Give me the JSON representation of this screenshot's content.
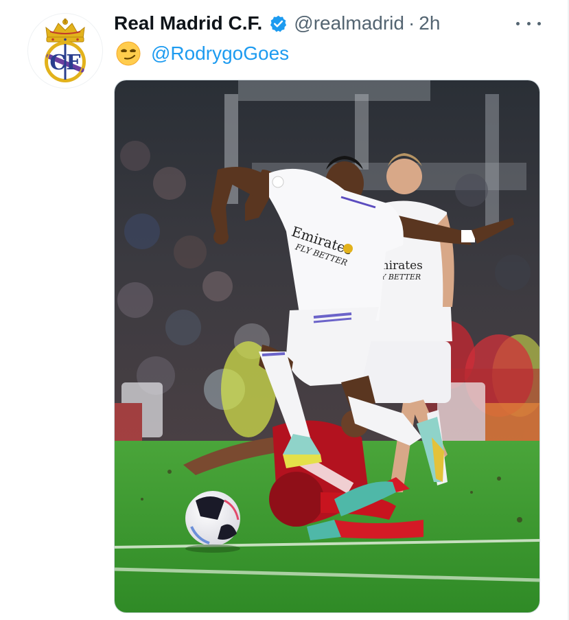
{
  "author": {
    "display_name": "Real Madrid C.F.",
    "handle": "@realmadrid",
    "separator": "·",
    "timestamp": "2h",
    "verified": true,
    "avatar_icon": "real-madrid-crest-icon"
  },
  "tweet": {
    "emoji": "😏",
    "mention": "@RodrygoGoes"
  },
  "media": {
    "kind": "photo",
    "jersey_sponsor_line1": "Emirates",
    "jersey_sponsor_line2": "FLY BETTER"
  },
  "icons": {
    "verified": "verified-badge-icon",
    "more": "more-options-icon"
  },
  "colors": {
    "text_primary": "#0f1419",
    "text_secondary": "#536471",
    "link": "#1d9bf0",
    "verified": "#1d9bf0",
    "crest_gold": "#e2b21c",
    "crest_blue": "#2a3e8e",
    "pitch_green": "#3f9a2c",
    "sevilla_red": "#b3121f"
  }
}
